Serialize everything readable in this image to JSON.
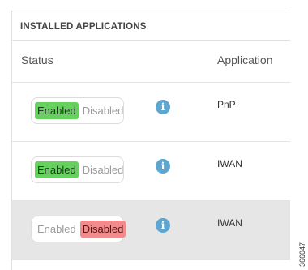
{
  "section_title": "INSTALLED APPLICATIONS",
  "columns": {
    "status": "Status",
    "application": "Application"
  },
  "rows": [
    {
      "enabled_label": "Enabled",
      "disabled_label": "Disabled",
      "state": "enabled",
      "application": "PnP"
    },
    {
      "enabled_label": "Enabled",
      "disabled_label": "Disabled",
      "state": "enabled",
      "application": "IWAN"
    },
    {
      "enabled_label": "Enabled",
      "disabled_label": "Disabled",
      "state": "disabled",
      "application": "IWAN"
    }
  ],
  "info_icon": "info-circle-icon",
  "colors": {
    "enabled": "#67d160",
    "disabled": "#f38b8d",
    "info": "#5ea5cf",
    "selected_row": "#e6e6e6"
  },
  "figure_id": "366047"
}
